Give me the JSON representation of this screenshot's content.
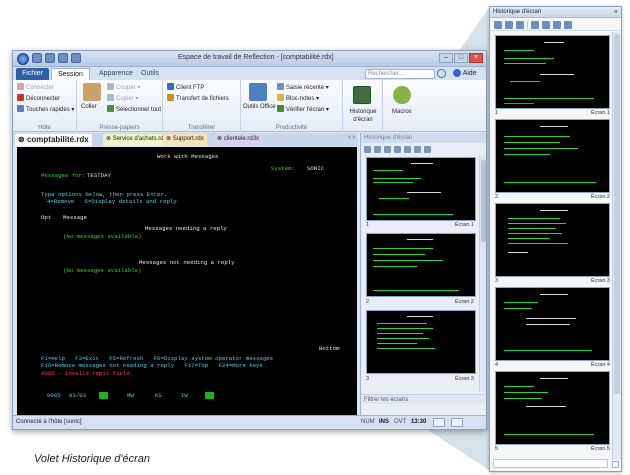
{
  "window": {
    "title": "Espace de travail de Reflection - [comptabilité.rdx]"
  },
  "ribbon_tabs": [
    {
      "label": "Fichier"
    },
    {
      "label": "Session"
    },
    {
      "label": "Apparence"
    },
    {
      "label": "Outils"
    }
  ],
  "search": {
    "placeholder": "Rechercher..."
  },
  "help": {
    "label": "Aide"
  },
  "groups": {
    "hote": {
      "title": "Hôte",
      "connect": "Connecter",
      "disconnect": "Déconnecter",
      "quick_keys": "Touches rapides"
    },
    "clipboard": {
      "title": "Presse-papiers",
      "paste": "Coller",
      "cut": "Couper",
      "copy": "Copier",
      "select_all": "Sélectionner tout"
    },
    "transfer": {
      "title": "Transférer",
      "ftp": "Client FTP",
      "file_transfer": "Transfert de fichiers"
    },
    "productivity": {
      "title": "Productivité",
      "office": "Outils Office",
      "recent": "Saisie récente",
      "notes": "Bloc-notes",
      "spell": "Vérifier l'écran"
    },
    "history": {
      "label": "Historique d'écran"
    },
    "macros": {
      "label": "Macros"
    }
  },
  "doc_tabs": [
    {
      "label": "comptabilité.rdx"
    },
    {
      "label": "Service d'achats.rdox"
    },
    {
      "label": "Support.rdx"
    },
    {
      "label": "clientele.rd3x"
    }
  ],
  "terminal": {
    "heading": "Work with Messages",
    "system_label": "System:",
    "system_value": "SONIC",
    "messages_for_label": "Messages for:",
    "messages_for_value": "TESTDAY",
    "instr1": "Type options below, then press Enter.",
    "instr2": "4=Remove   5=Display details and reply",
    "col_opt": "Opt",
    "col_message": "Message",
    "section1": "Messages needing a reply",
    "none1": "(No messages available)",
    "section2": "Messages not needing a reply",
    "none2": "(No messages available)",
    "bottom": "Bottom",
    "fkeys1": "F1=Help   F3=Exit   F5=Refresh   F6=Display system operator messages",
    "fkeys2": "F16=Remove messages not needing a reply   F17=Top   F24=More keys",
    "error": "0005 - Invalid repit field",
    "oia": [
      "0005",
      "03/03",
      "MW",
      "KS",
      "IW"
    ]
  },
  "status": {
    "message": "Connecté à l'hôte [sonic]",
    "indicators": [
      "NUM",
      "INS",
      "OVT"
    ],
    "time": "13:30"
  },
  "dock": {
    "title": "Historique d'écran",
    "screens": [
      {
        "number": "1",
        "label": "Écran 1"
      },
      {
        "number": "2",
        "label": "Écran 2"
      },
      {
        "number": "3",
        "label": "Écran 3"
      }
    ],
    "filter": "Filtrer les écrans"
  },
  "pane": {
    "title": "Historique d'écran",
    "screens": [
      {
        "number": "1",
        "label": "Écran 1"
      },
      {
        "number": "2",
        "label": "Écran 2"
      },
      {
        "number": "3",
        "label": "Écran 3"
      },
      {
        "number": "4",
        "label": "Écran 4"
      },
      {
        "number": "5",
        "label": "Écran 5"
      }
    ]
  },
  "caption": "Volet Historique d'écran",
  "colors": {
    "accent": "#2d5ea8",
    "terminal_bg": "#000000",
    "terminal_green": "#2fd32f",
    "terminal_red": "#ff3b3b"
  }
}
